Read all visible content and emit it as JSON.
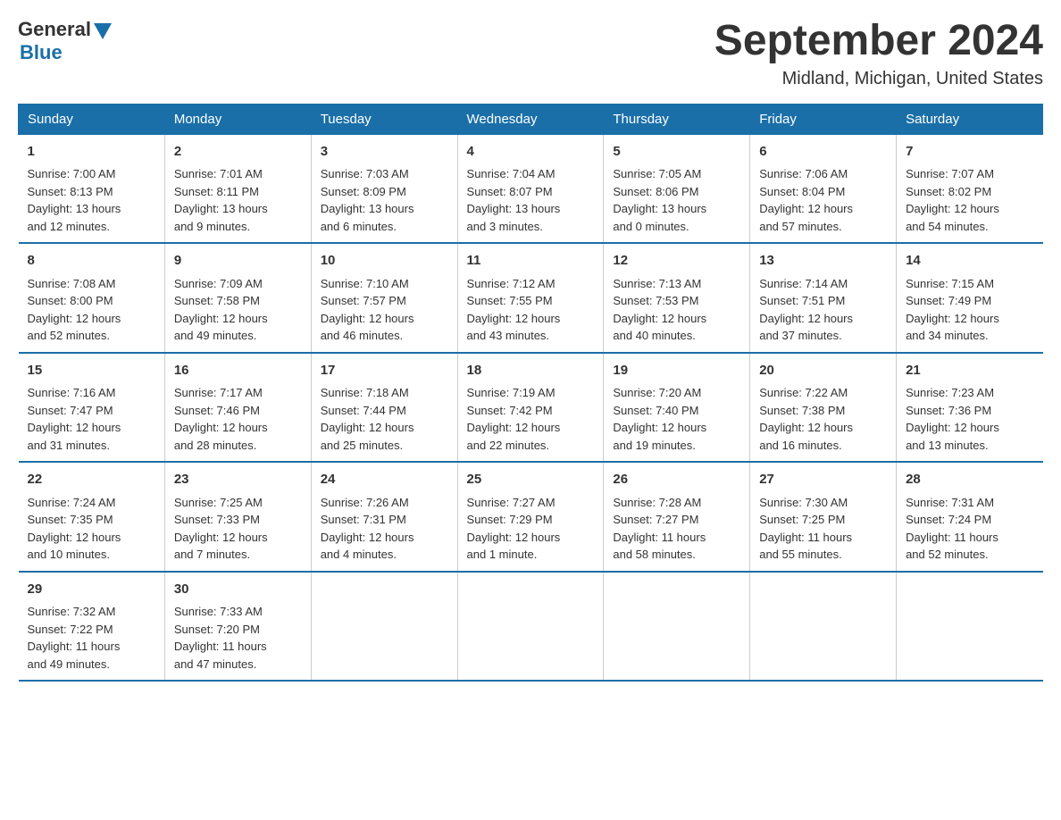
{
  "logo": {
    "general": "General",
    "blue": "Blue"
  },
  "title": "September 2024",
  "subtitle": "Midland, Michigan, United States",
  "days_header": [
    "Sunday",
    "Monday",
    "Tuesday",
    "Wednesday",
    "Thursday",
    "Friday",
    "Saturday"
  ],
  "weeks": [
    [
      {
        "day": "1",
        "info": "Sunrise: 7:00 AM\nSunset: 8:13 PM\nDaylight: 13 hours\nand 12 minutes."
      },
      {
        "day": "2",
        "info": "Sunrise: 7:01 AM\nSunset: 8:11 PM\nDaylight: 13 hours\nand 9 minutes."
      },
      {
        "day": "3",
        "info": "Sunrise: 7:03 AM\nSunset: 8:09 PM\nDaylight: 13 hours\nand 6 minutes."
      },
      {
        "day": "4",
        "info": "Sunrise: 7:04 AM\nSunset: 8:07 PM\nDaylight: 13 hours\nand 3 minutes."
      },
      {
        "day": "5",
        "info": "Sunrise: 7:05 AM\nSunset: 8:06 PM\nDaylight: 13 hours\nand 0 minutes."
      },
      {
        "day": "6",
        "info": "Sunrise: 7:06 AM\nSunset: 8:04 PM\nDaylight: 12 hours\nand 57 minutes."
      },
      {
        "day": "7",
        "info": "Sunrise: 7:07 AM\nSunset: 8:02 PM\nDaylight: 12 hours\nand 54 minutes."
      }
    ],
    [
      {
        "day": "8",
        "info": "Sunrise: 7:08 AM\nSunset: 8:00 PM\nDaylight: 12 hours\nand 52 minutes."
      },
      {
        "day": "9",
        "info": "Sunrise: 7:09 AM\nSunset: 7:58 PM\nDaylight: 12 hours\nand 49 minutes."
      },
      {
        "day": "10",
        "info": "Sunrise: 7:10 AM\nSunset: 7:57 PM\nDaylight: 12 hours\nand 46 minutes."
      },
      {
        "day": "11",
        "info": "Sunrise: 7:12 AM\nSunset: 7:55 PM\nDaylight: 12 hours\nand 43 minutes."
      },
      {
        "day": "12",
        "info": "Sunrise: 7:13 AM\nSunset: 7:53 PM\nDaylight: 12 hours\nand 40 minutes."
      },
      {
        "day": "13",
        "info": "Sunrise: 7:14 AM\nSunset: 7:51 PM\nDaylight: 12 hours\nand 37 minutes."
      },
      {
        "day": "14",
        "info": "Sunrise: 7:15 AM\nSunset: 7:49 PM\nDaylight: 12 hours\nand 34 minutes."
      }
    ],
    [
      {
        "day": "15",
        "info": "Sunrise: 7:16 AM\nSunset: 7:47 PM\nDaylight: 12 hours\nand 31 minutes."
      },
      {
        "day": "16",
        "info": "Sunrise: 7:17 AM\nSunset: 7:46 PM\nDaylight: 12 hours\nand 28 minutes."
      },
      {
        "day": "17",
        "info": "Sunrise: 7:18 AM\nSunset: 7:44 PM\nDaylight: 12 hours\nand 25 minutes."
      },
      {
        "day": "18",
        "info": "Sunrise: 7:19 AM\nSunset: 7:42 PM\nDaylight: 12 hours\nand 22 minutes."
      },
      {
        "day": "19",
        "info": "Sunrise: 7:20 AM\nSunset: 7:40 PM\nDaylight: 12 hours\nand 19 minutes."
      },
      {
        "day": "20",
        "info": "Sunrise: 7:22 AM\nSunset: 7:38 PM\nDaylight: 12 hours\nand 16 minutes."
      },
      {
        "day": "21",
        "info": "Sunrise: 7:23 AM\nSunset: 7:36 PM\nDaylight: 12 hours\nand 13 minutes."
      }
    ],
    [
      {
        "day": "22",
        "info": "Sunrise: 7:24 AM\nSunset: 7:35 PM\nDaylight: 12 hours\nand 10 minutes."
      },
      {
        "day": "23",
        "info": "Sunrise: 7:25 AM\nSunset: 7:33 PM\nDaylight: 12 hours\nand 7 minutes."
      },
      {
        "day": "24",
        "info": "Sunrise: 7:26 AM\nSunset: 7:31 PM\nDaylight: 12 hours\nand 4 minutes."
      },
      {
        "day": "25",
        "info": "Sunrise: 7:27 AM\nSunset: 7:29 PM\nDaylight: 12 hours\nand 1 minute."
      },
      {
        "day": "26",
        "info": "Sunrise: 7:28 AM\nSunset: 7:27 PM\nDaylight: 11 hours\nand 58 minutes."
      },
      {
        "day": "27",
        "info": "Sunrise: 7:30 AM\nSunset: 7:25 PM\nDaylight: 11 hours\nand 55 minutes."
      },
      {
        "day": "28",
        "info": "Sunrise: 7:31 AM\nSunset: 7:24 PM\nDaylight: 11 hours\nand 52 minutes."
      }
    ],
    [
      {
        "day": "29",
        "info": "Sunrise: 7:32 AM\nSunset: 7:22 PM\nDaylight: 11 hours\nand 49 minutes."
      },
      {
        "day": "30",
        "info": "Sunrise: 7:33 AM\nSunset: 7:20 PM\nDaylight: 11 hours\nand 47 minutes."
      },
      {
        "day": "",
        "info": ""
      },
      {
        "day": "",
        "info": ""
      },
      {
        "day": "",
        "info": ""
      },
      {
        "day": "",
        "info": ""
      },
      {
        "day": "",
        "info": ""
      }
    ]
  ]
}
